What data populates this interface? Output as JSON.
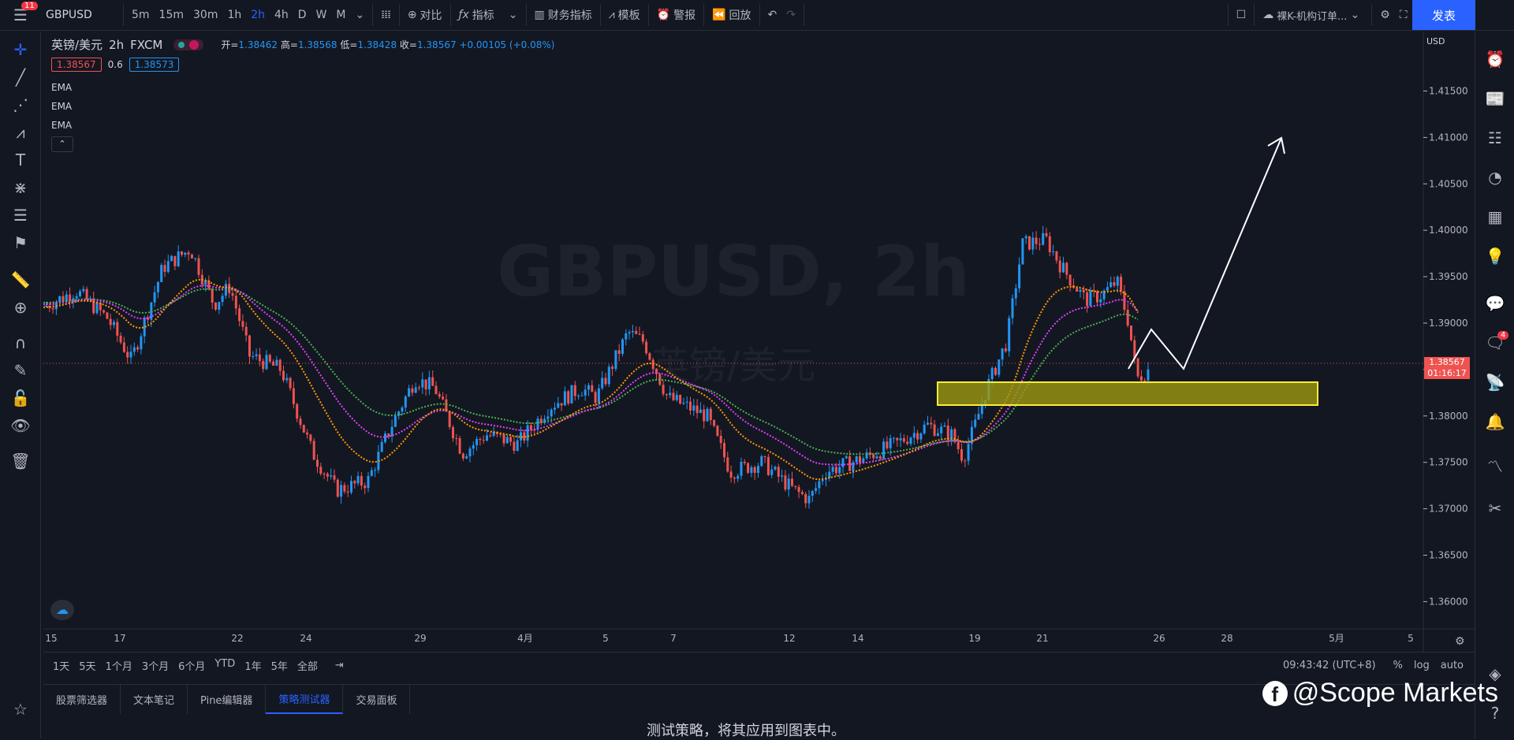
{
  "toolbar": {
    "notif_count": "11",
    "symbol": "GBPUSD",
    "intervals": [
      "5m",
      "15m",
      "30m",
      "1h",
      "2h",
      "4h",
      "D",
      "W",
      "M"
    ],
    "active_interval": "2h",
    "compare": "对比",
    "indicators": "指标",
    "financials": "财务指标",
    "templates": "模板",
    "alert": "警报",
    "replay": "回放",
    "layout_name": "裸K-机构订单...",
    "publish": "发表"
  },
  "legend": {
    "title": "英镑/美元",
    "interval": "2h",
    "source": "FXCM",
    "open_label": "开=",
    "open": "1.38462",
    "high_label": "高=",
    "high": "1.38568",
    "low_label": "低=",
    "low": "1.38428",
    "close_label": "收=",
    "close": "1.38567",
    "change": "+0.00105 (+0.08%)",
    "bid": "1.38567",
    "spread": "0.6",
    "ask": "1.38573",
    "ema_labels": [
      "EMA",
      "EMA",
      "EMA"
    ]
  },
  "watermark": {
    "symbol": "GBPUSD, 2h",
    "name": "英镑/美元"
  },
  "price_axis": {
    "currency": "USD",
    "ticks": [
      "1.41500",
      "1.41000",
      "1.40500",
      "1.40000",
      "1.39500",
      "1.39000",
      "1.38500",
      "1.38000",
      "1.37500",
      "1.37000",
      "1.36500",
      "1.36000"
    ],
    "current_price": "1.38567",
    "countdown": "01:16:17"
  },
  "time_axis": {
    "ticks": [
      "15",
      "17",
      "22",
      "24",
      "29",
      "4月",
      "5",
      "7",
      "12",
      "14",
      "19",
      "21",
      "26",
      "28",
      "5月",
      "5"
    ]
  },
  "bottom_bar": {
    "ranges": [
      "1天",
      "5天",
      "1个月",
      "3个月",
      "6个月",
      "YTD",
      "1年",
      "5年",
      "全部"
    ],
    "clock": "09:43:42 (UTC+8)",
    "pct": "%",
    "log": "log",
    "auto": "auto"
  },
  "panel": {
    "tabs": [
      "股票筛选器",
      "文本笔记",
      "Pine编辑器",
      "策略测试器",
      "交易面板"
    ],
    "active_tab": "策略测试器",
    "message": "测试策略，将其应用到图表中。"
  },
  "brand": {
    "text": "@Scope Markets"
  },
  "right_badge": "4",
  "colors": {
    "up": "#2196f3",
    "down": "#ef5350",
    "zone": "#ffeb3b",
    "ema1": "#4caf50",
    "ema2": "#e040fb",
    "ema3": "#ff9800",
    "accent": "#2962ff"
  }
}
